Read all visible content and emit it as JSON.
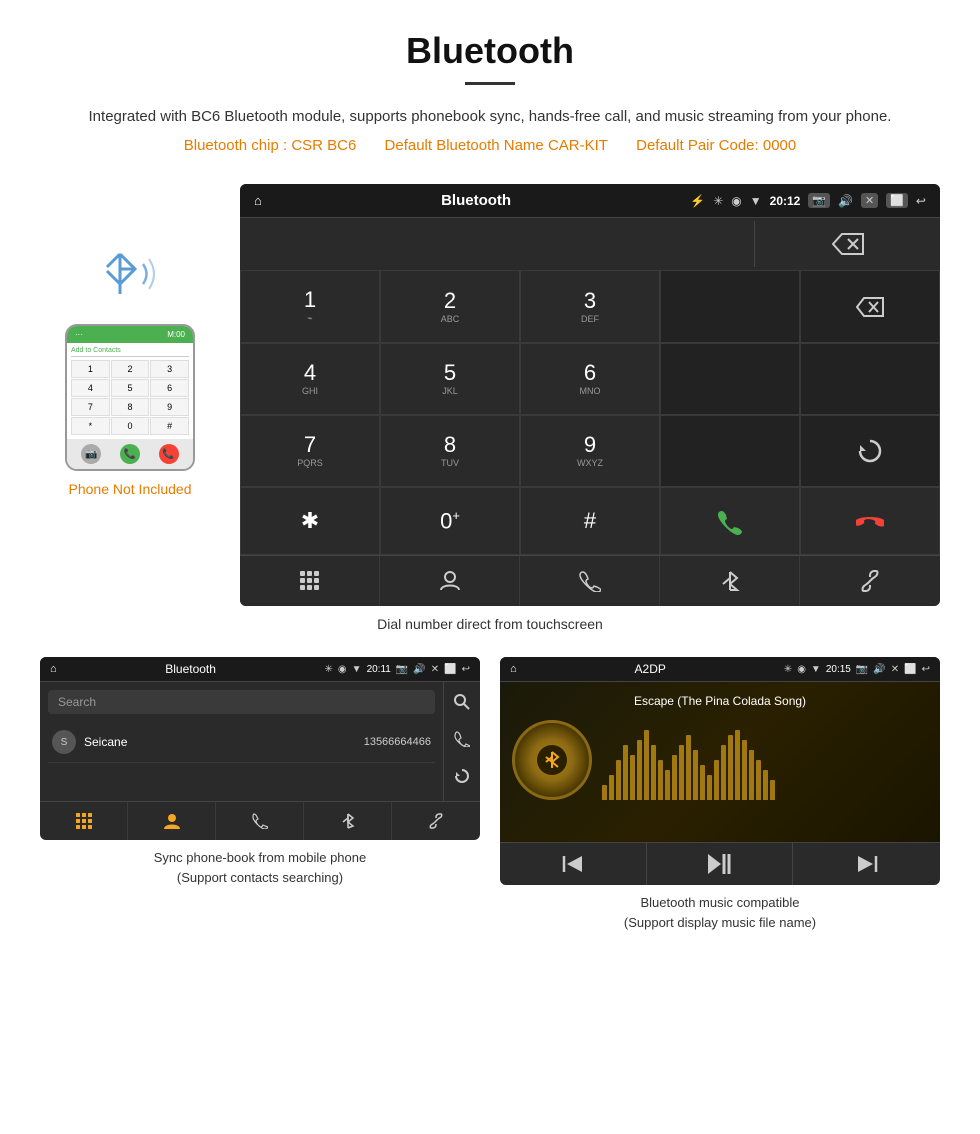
{
  "page": {
    "title": "Bluetooth",
    "description": "Integrated with BC6 Bluetooth module, supports phonebook sync, hands-free call, and music streaming from your phone.",
    "specs": {
      "chip": "Bluetooth chip : CSR BC6",
      "name": "Default Bluetooth Name CAR-KIT",
      "pair_code": "Default Pair Code: 0000"
    },
    "phone_not_included": "Phone Not Included",
    "dial_caption": "Dial number direct from touchscreen"
  },
  "car_screen": {
    "header": {
      "home_icon": "⌂",
      "title": "Bluetooth",
      "usb_icon": "⚡",
      "bt_icon": "✳",
      "location_icon": "◉",
      "signal_icon": "▼",
      "time": "20:12",
      "camera_icon": "📷",
      "volume_icon": "🔊",
      "close_icon": "✕",
      "window_icon": "⬜",
      "back_icon": "↩"
    },
    "keypad": [
      {
        "main": "1",
        "sub": "⌁",
        "col": 1
      },
      {
        "main": "2",
        "sub": "ABC",
        "col": 2
      },
      {
        "main": "3",
        "sub": "DEF",
        "col": 3
      },
      {
        "main": "",
        "sub": "",
        "col": 4
      },
      {
        "main": "⌫",
        "sub": "",
        "col": 5
      },
      {
        "main": "4",
        "sub": "GHI",
        "col": 1
      },
      {
        "main": "5",
        "sub": "JKL",
        "col": 2
      },
      {
        "main": "6",
        "sub": "MNO",
        "col": 3
      },
      {
        "main": "",
        "sub": "",
        "col": 4
      },
      {
        "main": "",
        "sub": "",
        "col": 5
      },
      {
        "main": "7",
        "sub": "PQRS",
        "col": 1
      },
      {
        "main": "8",
        "sub": "TUV",
        "col": 2
      },
      {
        "main": "9",
        "sub": "WXYZ",
        "col": 3
      },
      {
        "main": "",
        "sub": "",
        "col": 4
      },
      {
        "main": "↻",
        "sub": "",
        "col": 5
      },
      {
        "main": "✱",
        "sub": "",
        "col": 1
      },
      {
        "main": "0+",
        "sub": "",
        "col": 2
      },
      {
        "main": "#",
        "sub": "",
        "col": 3
      },
      {
        "main": "📞",
        "sub": "",
        "col": 4
      },
      {
        "main": "📞",
        "sub": "",
        "col": 5
      }
    ],
    "bottom_bar": [
      "⊞",
      "👤",
      "📞",
      "✳",
      "🔗"
    ]
  },
  "phonebook_screen": {
    "header": {
      "home_icon": "⌂",
      "title": "Bluetooth",
      "usb_icon": "⚡",
      "bt_icon": "✳",
      "location_icon": "◉",
      "signal_icon": "▼",
      "time": "20:11",
      "camera_icon": "📷",
      "volume_icon": "🔊",
      "close_icon": "✕",
      "window_icon": "⬜",
      "back_icon": "↩"
    },
    "search_placeholder": "Search",
    "contacts": [
      {
        "letter": "S",
        "name": "Seicane",
        "number": "13566664466"
      }
    ],
    "side_icons": [
      "🔍",
      "📞",
      "↻"
    ],
    "bottom_bar": [
      "⊞",
      "👤",
      "📞",
      "✳",
      "🔗"
    ],
    "caption_line1": "Sync phone-book from mobile phone",
    "caption_line2": "(Support contacts searching)"
  },
  "music_screen": {
    "header": {
      "home_icon": "⌂",
      "title": "A2DP",
      "usb_icon": "⚡",
      "bt_icon": "✳",
      "location_icon": "◉",
      "signal_icon": "▼",
      "time": "20:15",
      "camera_icon": "📷",
      "volume_icon": "🔊",
      "close_icon": "✕",
      "window_icon": "⬜",
      "back_icon": "↩"
    },
    "song_title": "Escape (The Pina Colada Song)",
    "eq_bars": [
      15,
      25,
      40,
      55,
      45,
      60,
      70,
      55,
      40,
      30,
      45,
      55,
      65,
      50,
      35,
      25,
      40,
      55,
      65,
      70,
      60,
      50,
      40,
      30,
      20
    ],
    "controls": [
      "⏮",
      "⏭|",
      "⏭"
    ],
    "caption_line1": "Bluetooth music compatible",
    "caption_line2": "(Support display music file name)"
  },
  "phone_mockup": {
    "status": "M:00",
    "add_contacts": "Add to Contacts",
    "keys": [
      "1",
      "2",
      "3",
      "4",
      "5",
      "6",
      "7",
      "8",
      "9",
      "*",
      "0",
      "#"
    ]
  }
}
